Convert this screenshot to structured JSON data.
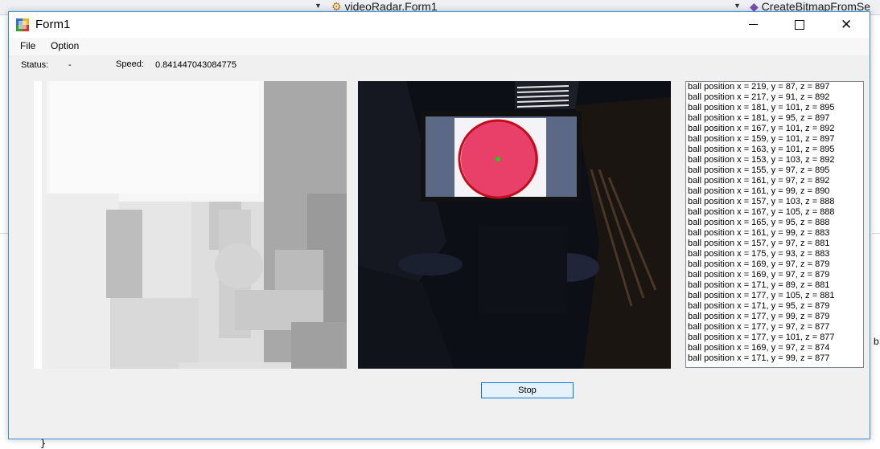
{
  "ide": {
    "dropdown_middle": "videoRadar.Form1",
    "dropdown_right": "CreateBitmapFromSe",
    "brace": "}",
    "right_text": "b"
  },
  "window": {
    "title": "Form1"
  },
  "menu": {
    "file": "File",
    "option": "Option"
  },
  "status": {
    "label": "Status:",
    "value": "-"
  },
  "speed": {
    "label": "Speed:",
    "value": "0.841447043084775"
  },
  "log": [
    "ball position x = 219, y = 87, z = 897",
    "ball position x = 217, y = 91, z = 892",
    "ball position x = 181, y = 101, z = 895",
    "ball position x = 181, y = 95, z = 897",
    "ball position x = 167, y = 101, z = 892",
    "ball position x = 159, y = 101, z = 897",
    "ball position x = 163, y = 101, z = 895",
    "ball position x = 153, y = 103, z = 892",
    "ball position x = 155, y = 97, z = 895",
    "ball position x = 161, y = 97, z = 892",
    "ball position x = 161, y = 99, z = 890",
    "ball position x = 157, y = 103, z = 888",
    "ball position x = 167, y = 105, z = 888",
    "ball position x = 165, y = 95, z = 888",
    "ball position x = 161, y = 99, z = 883",
    "ball position x = 157, y = 97, z = 881",
    "ball position x = 175, y = 93, z = 883",
    "ball position x = 169, y = 97, z = 879",
    "ball position x = 169, y = 97, z = 879",
    "ball position x = 171, y = 89, z = 881",
    "ball position x = 177, y = 105, z = 881",
    "ball position x = 171, y = 95, z = 879",
    "ball position x = 177, y = 99, z = 879",
    "ball position x = 177, y = 97, z = 877",
    "ball position x = 177, y = 101, z = 877",
    "ball position x = 169, y = 97, z = 874",
    "ball position x = 171, y = 99, z = 877"
  ],
  "buttons": {
    "stop": "Stop"
  }
}
